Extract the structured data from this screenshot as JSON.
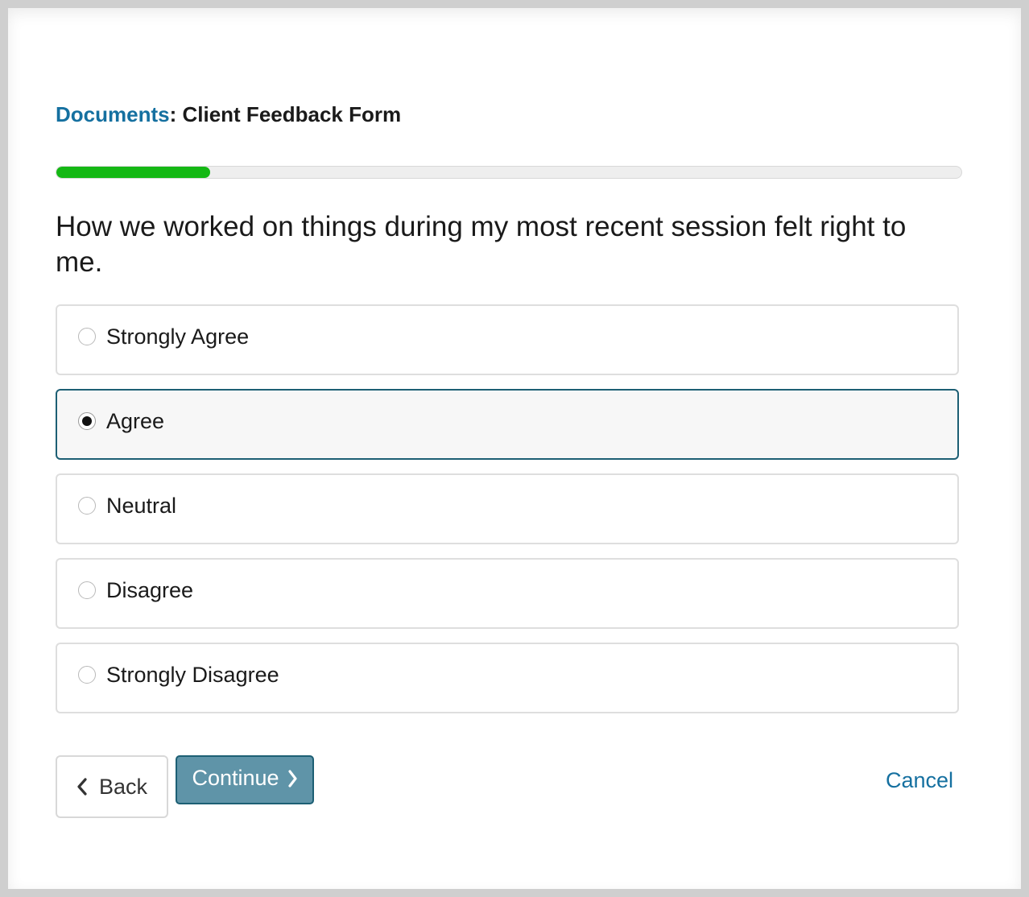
{
  "breadcrumb": {
    "link_label": "Documents",
    "separator": ":",
    "current": "Client Feedback Form"
  },
  "progress": {
    "fraction": 0.17,
    "color": "#14b814"
  },
  "question": {
    "text": "How we worked on things during my most recent session felt right to me."
  },
  "options": [
    {
      "label": "Strongly Agree",
      "selected": false
    },
    {
      "label": "Agree",
      "selected": true
    },
    {
      "label": "Neutral",
      "selected": false
    },
    {
      "label": "Disagree",
      "selected": false
    },
    {
      "label": "Strongly Disagree",
      "selected": false
    }
  ],
  "actions": {
    "back_label": "Back",
    "continue_label": "Continue",
    "cancel_label": "Cancel"
  },
  "colors": {
    "link": "#1570a0",
    "primary_button": "#5f94a8",
    "selected_border": "#1d5f74"
  },
  "icons": {
    "back": "chevron-left-icon",
    "continue": "chevron-right-icon",
    "selected_radio": "radio-checked-icon",
    "unselected_radio": "radio-unchecked-icon"
  }
}
